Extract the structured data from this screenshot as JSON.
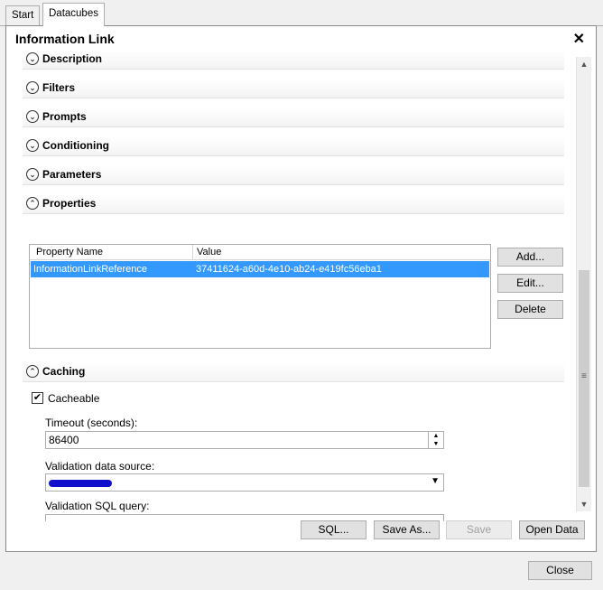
{
  "tabs": [
    {
      "label": "Start"
    },
    {
      "label": "Datacubes"
    }
  ],
  "dialog": {
    "title": "Information Link",
    "close_icon": "close-icon"
  },
  "sections": {
    "description": "Description",
    "filters": "Filters",
    "prompts": "Prompts",
    "conditioning": "Conditioning",
    "parameters": "Parameters",
    "properties": "Properties",
    "caching": "Caching"
  },
  "properties_table": {
    "columns": [
      "Property Name",
      "Value"
    ],
    "rows": [
      {
        "name": "InformationLinkReference",
        "value": "37411624-a60d-4e10-ab24-e419fc56eba1"
      }
    ]
  },
  "property_buttons": {
    "add": "Add...",
    "edit": "Edit...",
    "delete": "Delete"
  },
  "caching": {
    "cacheable_label": "Cacheable",
    "cacheable_checked": true,
    "timeout_label": "Timeout (seconds):",
    "timeout_value": "86400",
    "validation_source_label": "Validation data source:",
    "validation_sql_label": "Validation SQL query:",
    "validation_sql_value": ""
  },
  "footer": {
    "sql": "SQL...",
    "save_as": "Save As...",
    "save": "Save",
    "open_data": "Open Data"
  },
  "close_button": "Close",
  "icons": {
    "expand": "chevron-down-icon",
    "collapse": "chevron-up-icon",
    "check": "check-icon"
  }
}
